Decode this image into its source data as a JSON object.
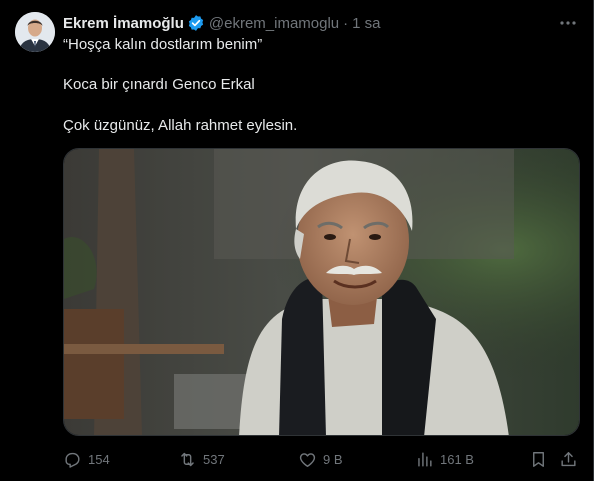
{
  "author": {
    "name": "Ekrem İmamoğlu",
    "handle": "@ekrem_imamoglu",
    "separator": "·",
    "time": "1 sa"
  },
  "tweet": {
    "line1": "“Hoşça kalın dostlarım benim”",
    "line2": "Koca bir çınardı Genco Erkal",
    "line3": "Çok üzgünüz, Allah rahmet eylesin."
  },
  "metrics": {
    "replies": "154",
    "retweets": "537",
    "likes": "9 B",
    "views": "161 B"
  },
  "colors": {
    "background": "#000000",
    "text": "#e7e9ea",
    "secondary": "#71767b",
    "verified": "#1d9bf0"
  },
  "icons": [
    "verified-badge-icon",
    "more-icon",
    "reply-icon",
    "retweet-icon",
    "like-icon",
    "views-icon",
    "bookmark-icon",
    "share-icon"
  ]
}
